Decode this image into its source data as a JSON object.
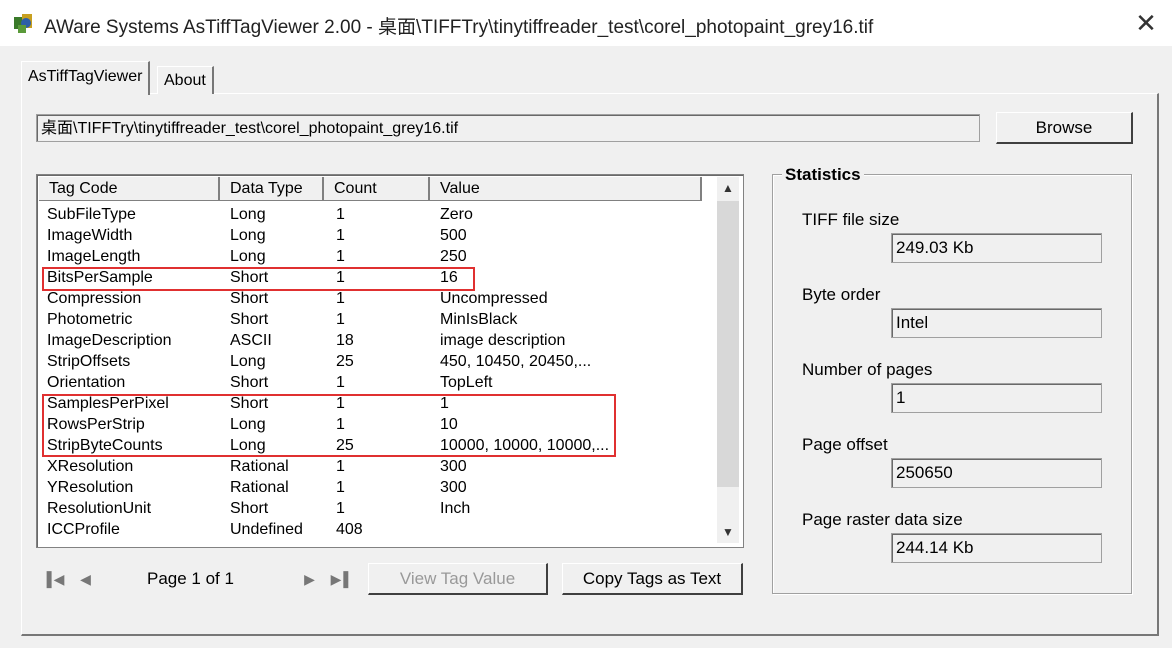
{
  "window": {
    "title": "AWare Systems  AsTiffTagViewer  2.00  -  桌面\\TIFFTry\\tinytiffreader_test\\corel_photopaint_grey16.tif",
    "close_label": "✕"
  },
  "tabs": [
    {
      "label": "AsTiffTagViewer",
      "active": true
    },
    {
      "label": "About",
      "active": false
    }
  ],
  "path_field": {
    "value": "桌面\\TIFFTry\\tinytiffreader_test\\corel_photopaint_grey16.tif"
  },
  "browse_label": "Browse",
  "table": {
    "columns": [
      "Tag Code",
      "Data Type",
      "Count",
      "Value"
    ],
    "rows": [
      [
        "SubFileType",
        "Long",
        "1",
        "Zero"
      ],
      [
        "ImageWidth",
        "Long",
        "1",
        "500"
      ],
      [
        "ImageLength",
        "Long",
        "1",
        "250"
      ],
      [
        "BitsPerSample",
        "Short",
        "1",
        "16"
      ],
      [
        "Compression",
        "Short",
        "1",
        "Uncompressed"
      ],
      [
        "Photometric",
        "Short",
        "1",
        "MinIsBlack"
      ],
      [
        "ImageDescription",
        "ASCII",
        "18",
        "image description"
      ],
      [
        "StripOffsets",
        "Long",
        "25",
        "450, 10450, 20450,..."
      ],
      [
        "Orientation",
        "Short",
        "1",
        "TopLeft"
      ],
      [
        "SamplesPerPixel",
        "Short",
        "1",
        "1"
      ],
      [
        "RowsPerStrip",
        "Long",
        "1",
        "10"
      ],
      [
        "StripByteCounts",
        "Long",
        "25",
        "10000, 10000, 10000,..."
      ],
      [
        "XResolution",
        "Rational",
        "1",
        "300"
      ],
      [
        "YResolution",
        "Rational",
        "1",
        "300"
      ],
      [
        "ResolutionUnit",
        "Short",
        "1",
        "Inch"
      ],
      [
        "ICCProfile",
        "Undefined",
        "408",
        ""
      ]
    ]
  },
  "pagination": {
    "label": "Page 1 of 1"
  },
  "buttons": {
    "view_tag_value": "View Tag Value",
    "copy_tags": "Copy Tags as Text"
  },
  "statistics": {
    "title": "Statistics",
    "items": [
      {
        "label": "TIFF file size",
        "value": "249.03 Kb"
      },
      {
        "label": "Byte order",
        "value": "Intel"
      },
      {
        "label": "Number of pages",
        "value": "1"
      },
      {
        "label": "Page offset",
        "value": "250650"
      },
      {
        "label": "Page raster data size",
        "value": "244.14 Kb"
      }
    ]
  },
  "colors": {
    "highlight": "#e03030",
    "background": "#f0f0f0"
  }
}
